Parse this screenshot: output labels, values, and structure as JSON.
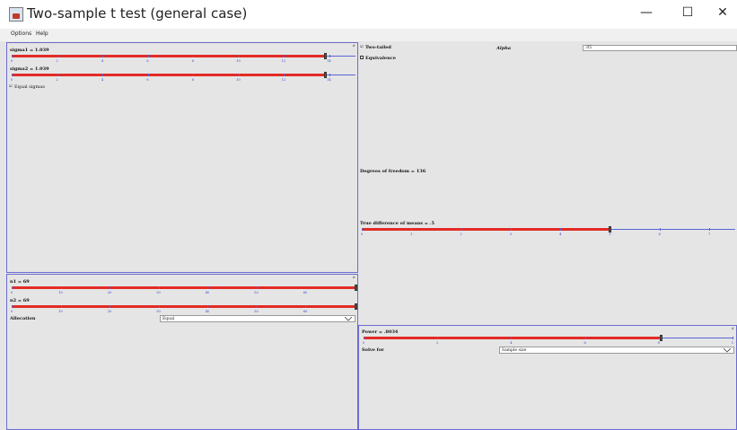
{
  "window": {
    "title": "Two-sample t test (general case)",
    "minimize": "—",
    "maximize": "☐",
    "close": "✕"
  },
  "menu": {
    "options": "Options",
    "help": "Help"
  },
  "sigma_panel": {
    "sigma1_label": "sigma1 = 1.039",
    "sigma1_value_fraction": 0.91,
    "sigma2_label": "sigma2 = 1.039",
    "sigma2_value_fraction": 0.91,
    "ticks": [
      "0",
      "2",
      "4",
      "6",
      "8",
      "10",
      "12",
      "14"
    ],
    "equal_sigmas_label": "Equal sigmas",
    "equal_sigmas_checked": true
  },
  "n_panel": {
    "n1_label": "n1 = 69",
    "n2_label": "n2 = 69",
    "ticks": [
      "0",
      "10",
      "20",
      "30",
      "40",
      "50",
      "60"
    ],
    "allocation_label": "Allocation",
    "allocation_value": "Equal"
  },
  "right_panel": {
    "two_tailed_label": "Two-tailed",
    "two_tailed_checked": true,
    "equivalence_label": "Equivalence",
    "equivalence_checked": false,
    "alpha_label": "Alpha",
    "alpha_value": ".05",
    "df_label": "Degrees of freedom = 136",
    "diff_label": "True difference of means = .5",
    "diff_ticks": [
      "0",
      "1",
      "2",
      "3",
      "4",
      "5",
      "6",
      "7"
    ]
  },
  "power_panel": {
    "power_label": "Power = .8034",
    "ticks": [
      "0",
      "2",
      "4",
      "6",
      "8",
      "1"
    ],
    "solve_for_label": "Solve for",
    "solve_for_value": "Sample size"
  }
}
